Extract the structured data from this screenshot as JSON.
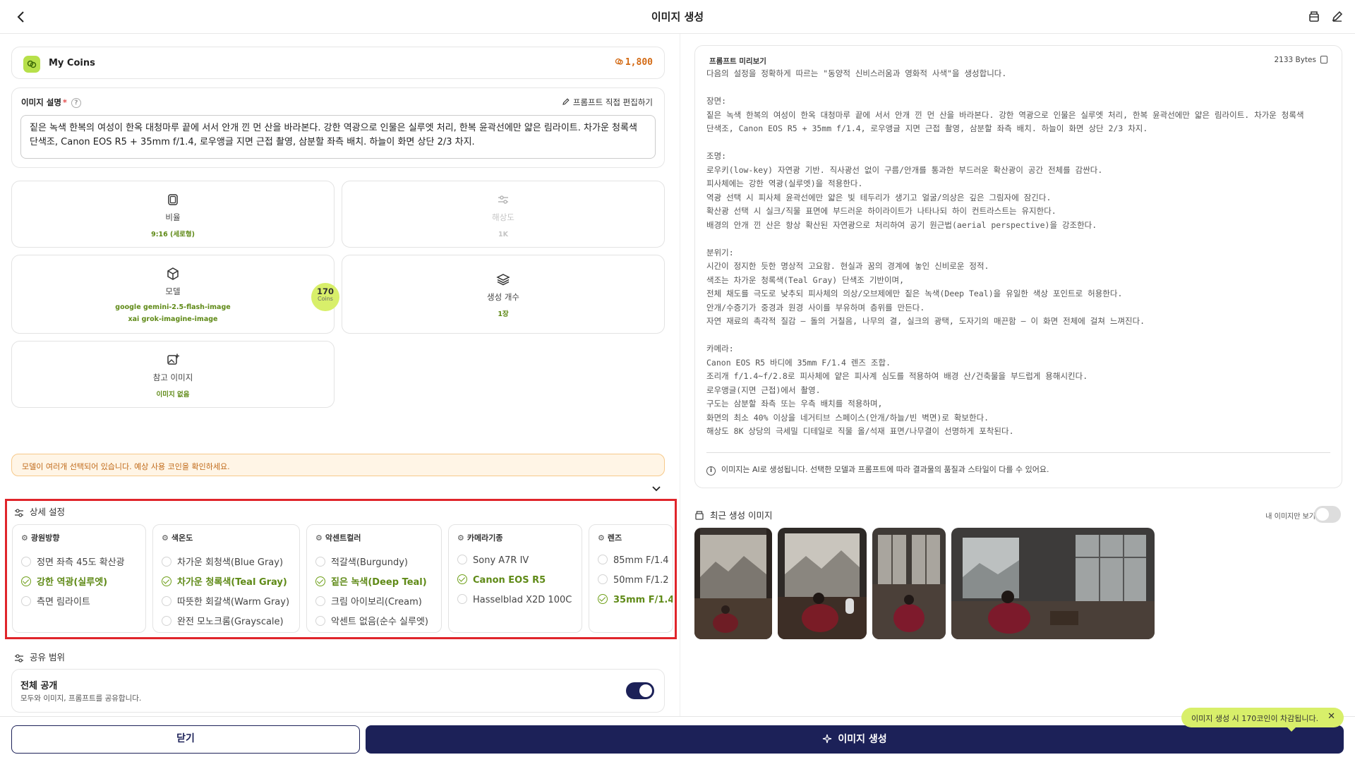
{
  "header": {
    "title": "이미지 생성"
  },
  "coins": {
    "label": "My Coins",
    "value": "1,800"
  },
  "description": {
    "label": "이미지 설명",
    "required_mark": "*",
    "edit_label": "프롬프트 직접 편집하기",
    "text": "짙은 녹색 한복의 여성이 한옥 대청마루 끝에 서서 안개 낀 먼 산을 바라본다. 강한 역광으로 인물은 실루엣 처리, 한복 윤곽선에만 얇은 림라이트. 차가운 청록색 단색조, Canon EOS R5 + 35mm f/1.4, 로우앵글 지면 근접 촬영, 삼분할 좌측 배치. 하늘이 화면 상단 2/3 차지."
  },
  "options": {
    "ratio": {
      "title": "비율",
      "value": "9:16 (세로형)"
    },
    "resolution": {
      "title": "해상도",
      "value": "1K"
    },
    "model": {
      "title": "모델",
      "value1": "google gemini-2.5-flash-image",
      "value2": "xai grok-imagine-image",
      "coins": "170",
      "coins_label": "Coins"
    },
    "count": {
      "title": "생성 개수",
      "value": "1장"
    },
    "reference": {
      "title": "참고 이미지",
      "value": "이미지 없음"
    }
  },
  "warning": "모델이 여러개 선택되어 있습니다. 예상 사용 코인을 확인하세요.",
  "advanced": {
    "title": "상세 설정",
    "columns": [
      {
        "title": "광원방향",
        "items": [
          "정면 좌측 45도 확산광",
          "강한 역광(실루엣)",
          "측면 림라이트"
        ],
        "selected": 1
      },
      {
        "title": "색온도",
        "items": [
          "차가운 회청색(Blue Gray)",
          "차가운 청록색(Teal Gray)",
          "따뜻한 회갈색(Warm Gray)",
          "완전 모노크롬(Grayscale)"
        ],
        "selected": 1
      },
      {
        "title": "악센트컬러",
        "items": [
          "적갈색(Burgundy)",
          "짙은 녹색(Deep Teal)",
          "크림 아이보리(Cream)",
          "악센트 없음(순수 실루엣)"
        ],
        "selected": 1
      },
      {
        "title": "카메라기종",
        "items": [
          "Sony A7R IV",
          "Canon EOS R5",
          "Hasselblad X2D 100C"
        ],
        "selected": 1
      },
      {
        "title": "렌즈",
        "items": [
          "85mm F/1.4",
          "50mm F/1.2",
          "35mm F/1.4"
        ],
        "selected": 2
      }
    ]
  },
  "share": {
    "section_title": "공유 범위",
    "label": "전체 공개",
    "sub": "모두와 이미지, 프롬프트를 공유합니다.",
    "enabled": true
  },
  "preview": {
    "title": "프롬프트 미리보기",
    "bytes": "2133 Bytes",
    "text": "다음의 설정을 정확하게 따르는 \"동양적 신비스러움과 영화적 사색\"을 생성합니다.\n\n장면:\n짙은 녹색 한복의 여성이 한옥 대청마루 끝에 서서 안개 낀 먼 산을 바라본다. 강한 역광으로 인물은 실루엣 처리, 한복 윤곽선에만 얇은 림라이트. 차가운 청록색\n단색조, Canon EOS R5 + 35mm f/1.4, 로우앵글 지면 근접 촬영, 삼분할 좌측 배치. 하늘이 화면 상단 2/3 차지.\n\n조명:\n로우키(low-key) 자연광 기반. 직사광선 없이 구름/안개를 통과한 부드러운 확산광이 공간 전체를 감싼다.\n피사체에는 강한 역광(실루엣)을 적용한다.\n역광 선택 시 피사체 윤곽선에만 얇은 빛 테두리가 생기고 얼굴/의상은 깊은 그림자에 잠긴다.\n확산광 선택 시 실크/직물 표면에 부드러운 하이라이트가 나타나되 하이 컨트라스트는 유지한다.\n배경의 안개 낀 산은 항상 확산된 자연광으로 처리하여 공기 원근법(aerial perspective)을 강조한다.\n\n분위기:\n시간이 정지한 듯한 명상적 고요함. 현실과 꿈의 경계에 놓인 신비로운 정적.\n색조는 차가운 청록색(Teal Gray) 단색조 기반이며,\n전체 채도를 극도로 낮추되 피사체의 의상/오브제에만 짙은 녹색(Deep Teal)을 유일한 색상 포인트로 허용한다.\n안개/수증기가 중경과 원경 사이를 부유하며 층위를 만든다.\n자연 재료의 촉각적 질감 — 돌의 거칠음, 나무의 결, 실크의 광택, 도자기의 매끈함 — 이 화면 전체에 걸쳐 느껴진다.\n\n카메라:\nCanon EOS R5 바디에 35mm F/1.4 렌즈 조합.\n조리개 f/1.4~f/2.8로 피사체에 얕은 피사계 심도를 적용하여 배경 산/건축물을 부드럽게 용해시킨다.\n로우앵글(지면 근접)에서 촬영.\n구도는 삼분할 좌측 또는 우측 배치를 적용하며,\n화면의 최소 40% 이상을 네거티브 스페이스(안개/하늘/빈 벽면)로 확보한다.\n해상도 8K 상당의 극세밀 디테일로 직물 올/석재 표면/나무결이 선명하게 포착된다.",
    "note": "이미지는 AI로 생성됩니다. 선택한 모델과 프롬프트에 따라 결과물의 품질과 스타일이 다를 수 있어요."
  },
  "recent": {
    "title": "최근 생성 이미지",
    "my_only": "내 이미지만 보기"
  },
  "footer": {
    "close": "닫기",
    "generate": "이미지 생성"
  },
  "toast": "이미지 생성 시 170코인이 차감됩니다."
}
